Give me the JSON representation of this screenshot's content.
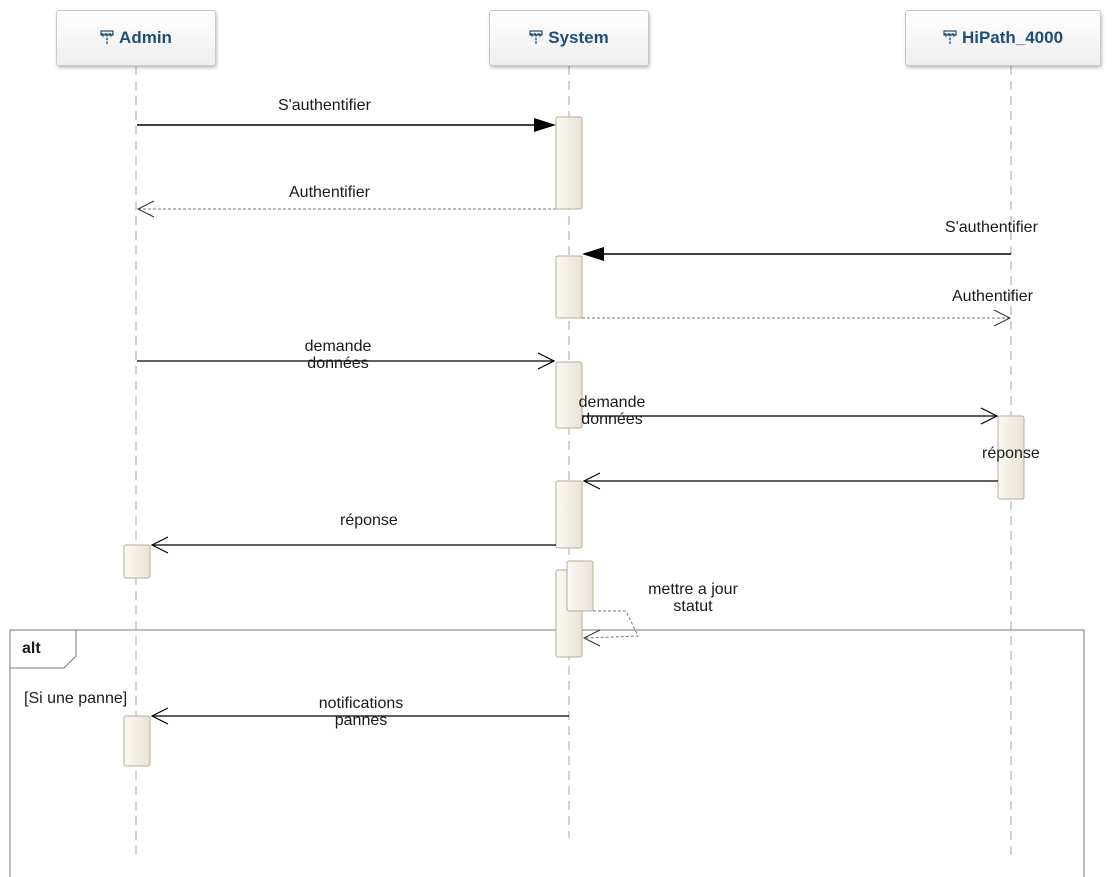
{
  "lifelines": [
    {
      "id": "admin",
      "name": "Admin",
      "icon": "lifeline-icon"
    },
    {
      "id": "system",
      "name": "System",
      "icon": "lifeline-icon"
    },
    {
      "id": "hipath",
      "name": "HiPath_4000",
      "icon": "lifeline-icon"
    }
  ],
  "messages": {
    "m1": "S'authentifier",
    "m2": "Authentifier",
    "m3": "S'authentifier",
    "m4": "Authentifier",
    "m5_line1": "demande",
    "m5_line2": "données",
    "m6_line1": "demande",
    "m6_line2": "données",
    "m7": "réponse",
    "m8": "réponse",
    "m9_line1": "mettre a jour",
    "m9_line2": "statut",
    "m10_line1": "notifications",
    "m10_line2": "pannes"
  },
  "fragment": {
    "operator": "alt",
    "guard": "[Si une panne]"
  },
  "colors": {
    "lifeline_name": "#1e4f7a",
    "activation_fill": "#f1ede4",
    "activation_border": "#b7ad96",
    "line": "#000000"
  }
}
